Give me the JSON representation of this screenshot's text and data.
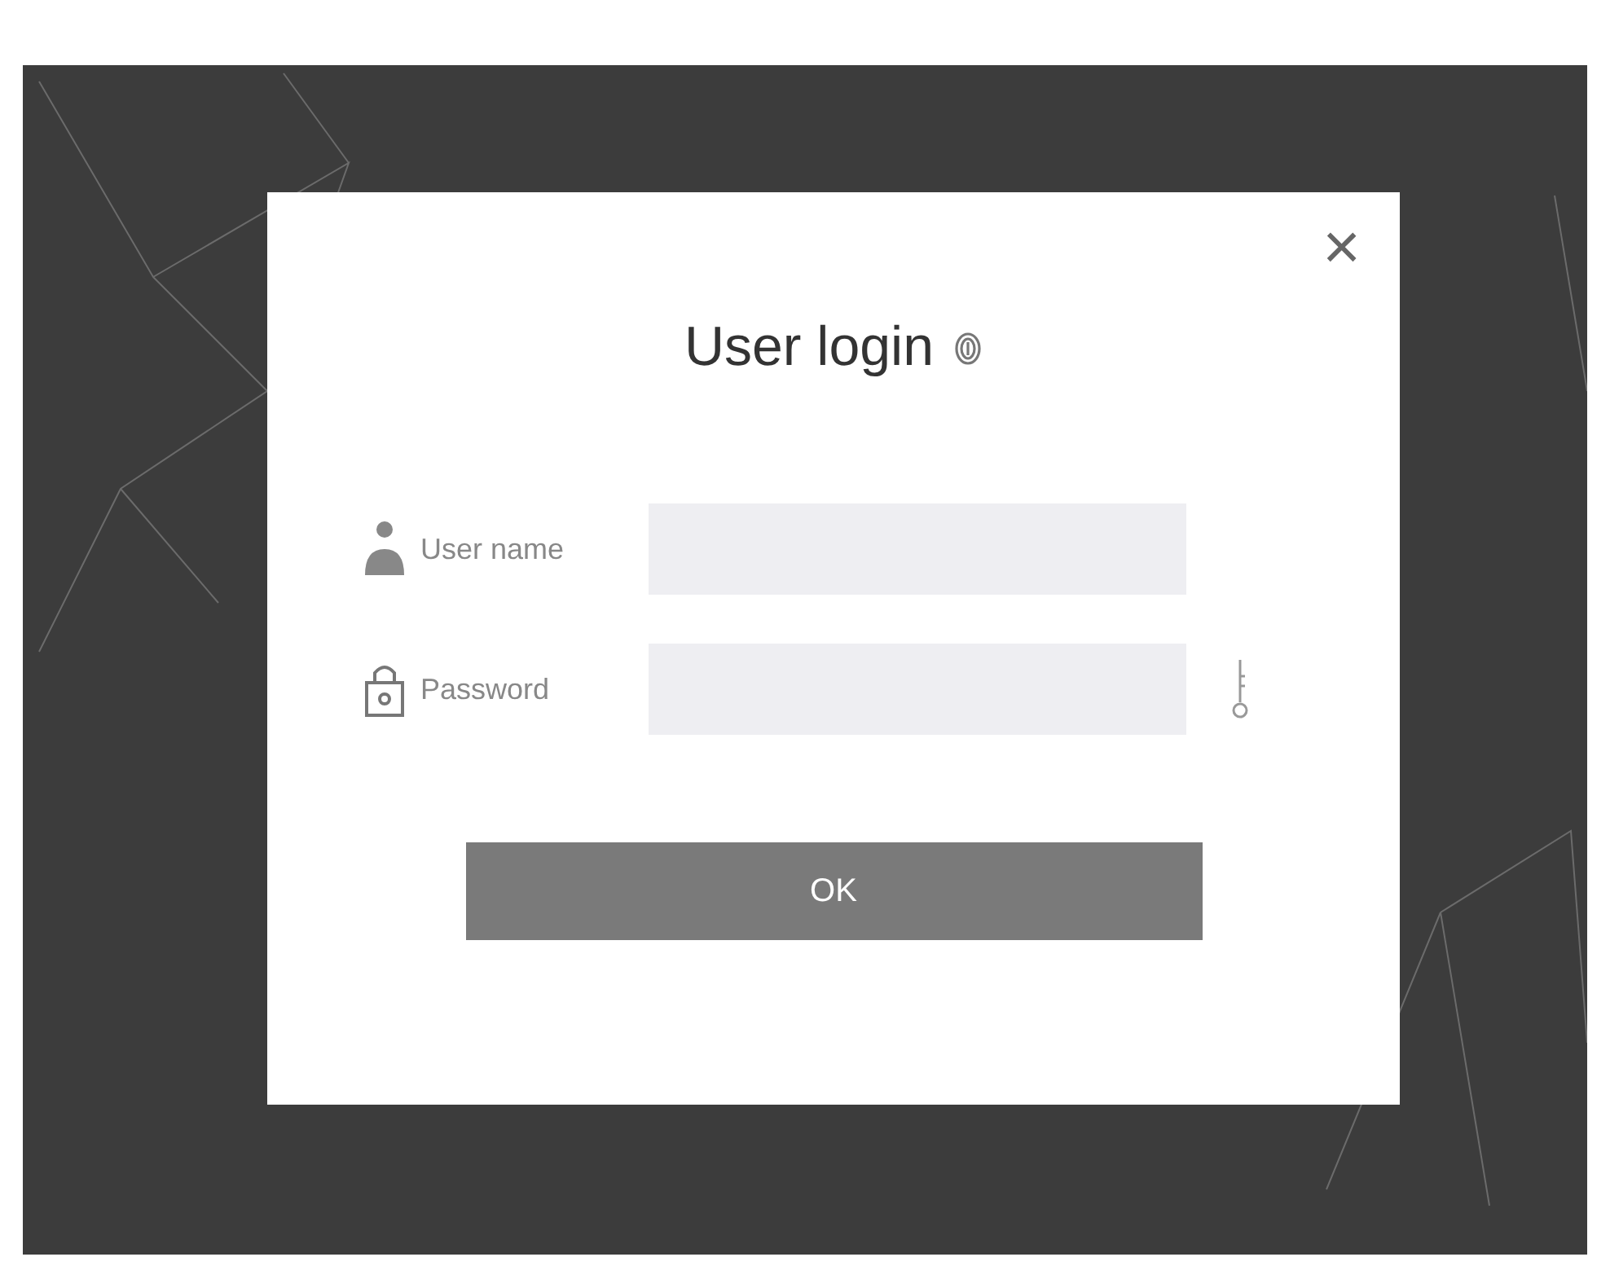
{
  "dialog": {
    "title": "User login",
    "close": "×",
    "fields": [
      {
        "kind": "user",
        "label": "User name"
      },
      {
        "kind": "password",
        "label": "Password"
      }
    ],
    "button": "OK"
  }
}
